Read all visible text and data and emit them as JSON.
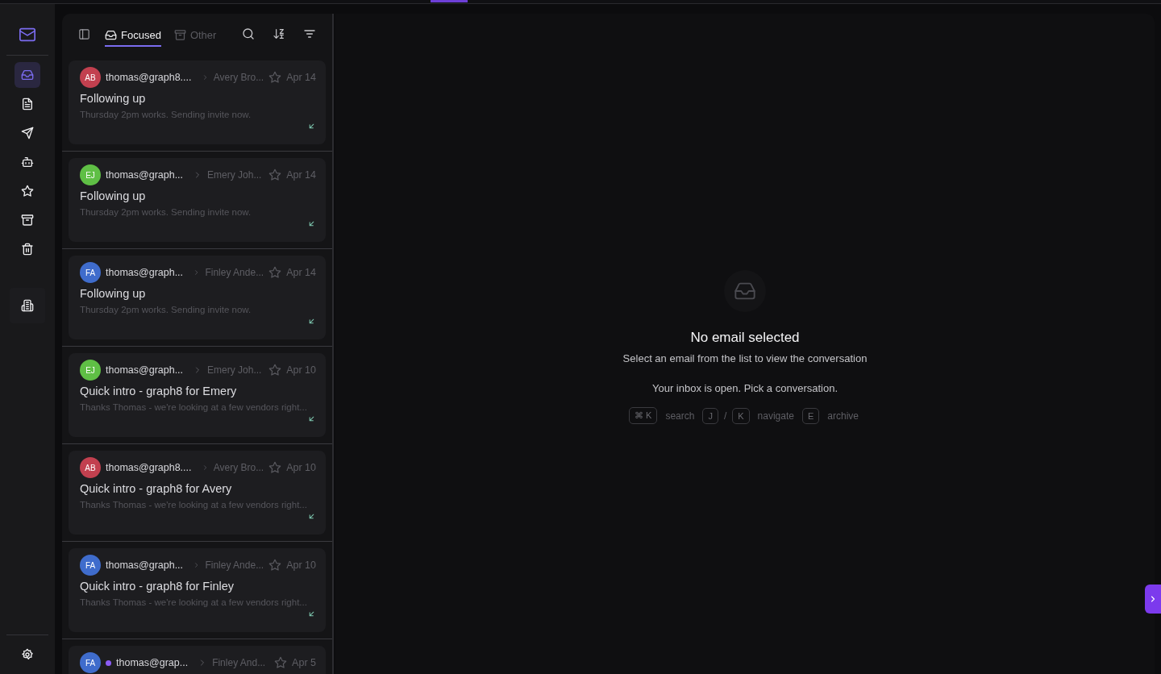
{
  "rail": {
    "items": [
      {
        "kind": "inbox",
        "selected": true
      },
      {
        "kind": "drafts",
        "selected": false
      },
      {
        "kind": "sent",
        "selected": false
      },
      {
        "kind": "bot",
        "selected": false
      },
      {
        "kind": "starred",
        "selected": false
      },
      {
        "kind": "archive",
        "selected": false
      },
      {
        "kind": "trash",
        "selected": false
      }
    ]
  },
  "list": {
    "tabs": [
      {
        "kind": "focused",
        "label": "Focused",
        "selected": true
      },
      {
        "kind": "other",
        "label": "Other",
        "selected": false
      }
    ],
    "emails": [
      {
        "initials": "AB",
        "color": "#c2404f",
        "unread": false,
        "from": "thomas@graph8....",
        "to": "Avery Bro...",
        "starred": false,
        "date": "Apr 14",
        "subject": "Following up",
        "preview": "Thursday 2pm works. Sending invite now."
      },
      {
        "initials": "EJ",
        "color": "#5fbf45",
        "unread": false,
        "from": "thomas@graph...",
        "to": "Emery Joh...",
        "starred": false,
        "date": "Apr 14",
        "subject": "Following up",
        "preview": "Thursday 2pm works. Sending invite now."
      },
      {
        "initials": "FA",
        "color": "#3f6ccc",
        "unread": false,
        "from": "thomas@graph...",
        "to": "Finley Ande...",
        "starred": false,
        "date": "Apr 14",
        "subject": "Following up",
        "preview": "Thursday 2pm works. Sending invite now."
      },
      {
        "initials": "EJ",
        "color": "#5fbf45",
        "unread": false,
        "from": "thomas@graph...",
        "to": "Emery Joh...",
        "starred": false,
        "date": "Apr 10",
        "subject": "Quick intro - graph8 for Emery",
        "preview": "Thanks Thomas - we're looking at a few vendors right..."
      },
      {
        "initials": "AB",
        "color": "#c2404f",
        "unread": false,
        "from": "thomas@graph8....",
        "to": "Avery Bro...",
        "starred": false,
        "date": "Apr 10",
        "subject": "Quick intro - graph8 for Avery",
        "preview": "Thanks Thomas - we're looking at a few vendors right..."
      },
      {
        "initials": "FA",
        "color": "#3f6ccc",
        "unread": false,
        "from": "thomas@graph...",
        "to": "Finley Ande...",
        "starred": false,
        "date": "Apr 10",
        "subject": "Quick intro - graph8 for Finley",
        "preview": "Thanks Thomas - we're looking at a few vendors right..."
      },
      {
        "initials": "FA",
        "color": "#3f6ccc",
        "unread": true,
        "from": "thomas@grap...",
        "to": "Finley And...",
        "starred": false,
        "date": "Apr 5"
      }
    ]
  },
  "empty": {
    "title": "No email selected",
    "subtitle": "Select an email from the list to view the conversation",
    "note": "Your inbox is open. Pick a conversation.",
    "shortcuts": [
      {
        "keys": [
          "⌘ K"
        ],
        "label": "search"
      },
      {
        "keys": [
          "J",
          "K"
        ],
        "joiner": "/",
        "label": "navigate"
      },
      {
        "keys": [
          "E"
        ],
        "label": "archive"
      }
    ]
  }
}
